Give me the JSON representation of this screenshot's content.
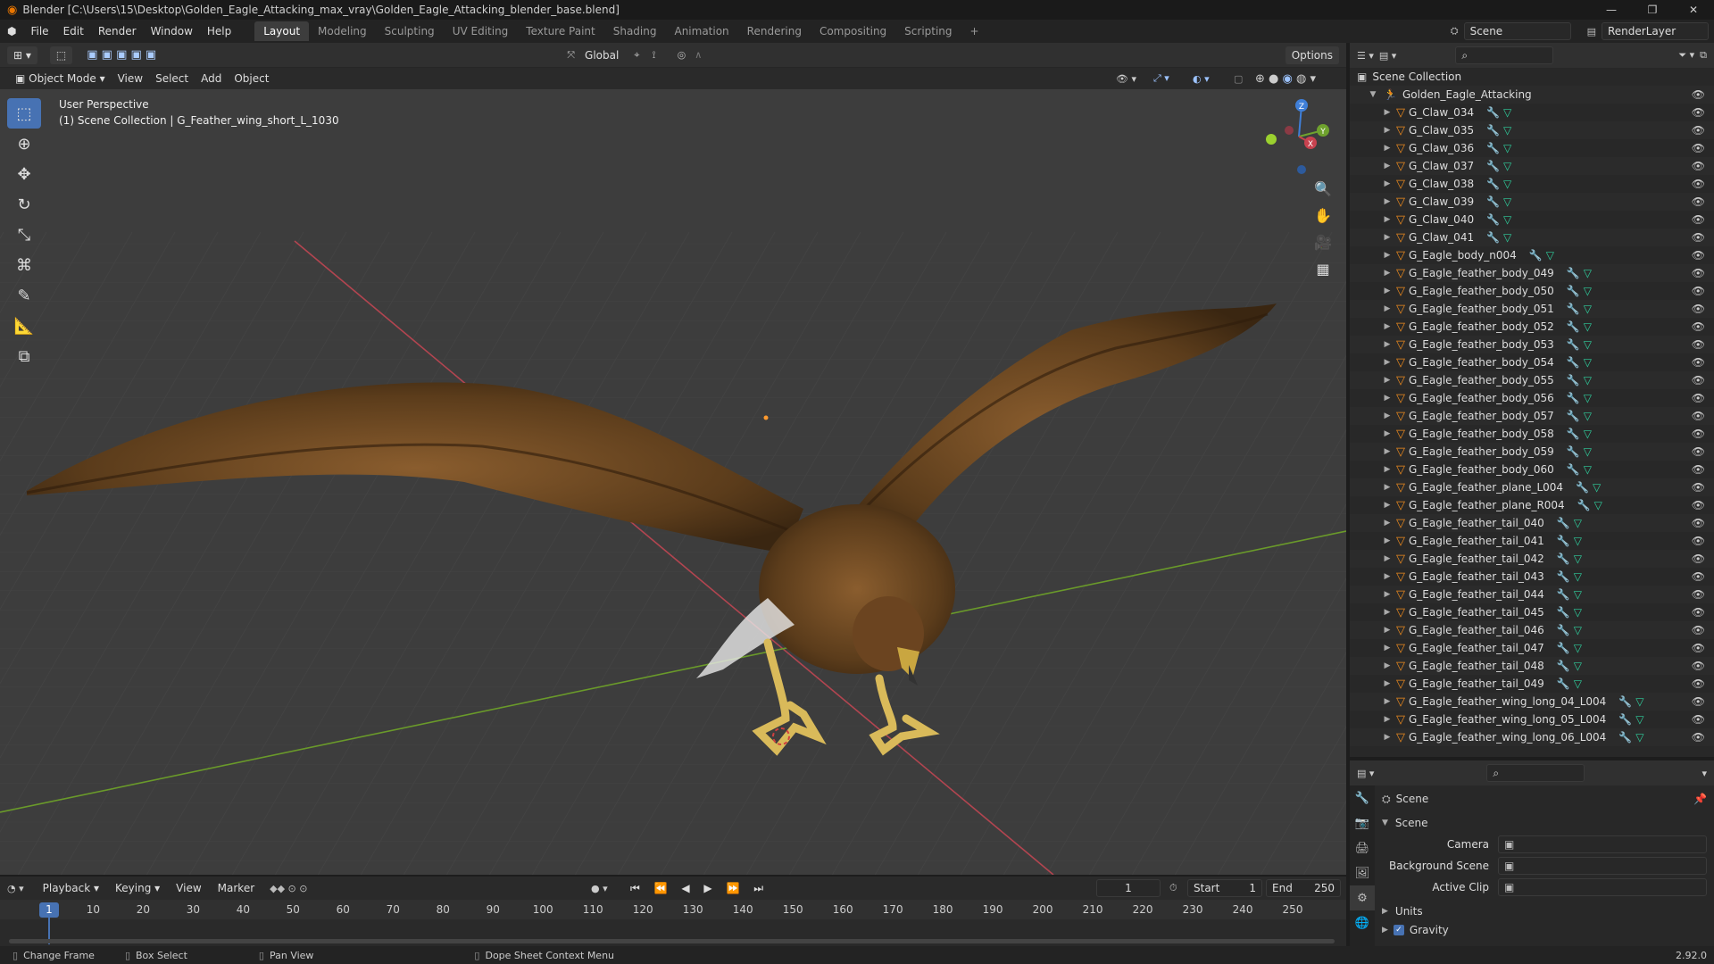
{
  "window": {
    "title": "Blender [C:\\Users\\15\\Desktop\\Golden_Eagle_Attacking_max_vray\\Golden_Eagle_Attacking_blender_base.blend]",
    "controls": [
      "—",
      "❐",
      "✕"
    ]
  },
  "menu": {
    "items": [
      "File",
      "Edit",
      "Render",
      "Window",
      "Help"
    ],
    "workspaces": [
      "Layout",
      "Modeling",
      "Sculpting",
      "UV Editing",
      "Texture Paint",
      "Shading",
      "Animation",
      "Rendering",
      "Compositing",
      "Scripting"
    ],
    "add_tab": "+",
    "scene": "Scene",
    "view_layer": "RenderLayer"
  },
  "tool_header": {
    "orientation": "Global",
    "options": "Options"
  },
  "viewport_header": {
    "mode": "Object Mode",
    "menus": [
      "View",
      "Select",
      "Add",
      "Object"
    ]
  },
  "viewport": {
    "perspective": "User Perspective",
    "collection_info": "(1) Scene Collection | G_Feather_wing_short_L_1030",
    "axis_labels": {
      "x": "X",
      "y": "Y",
      "z": "Z"
    }
  },
  "outliner": {
    "root": "Scene Collection",
    "collection": "Golden_Eagle_Attacking",
    "objects": [
      "G_Claw_034",
      "G_Claw_035",
      "G_Claw_036",
      "G_Claw_037",
      "G_Claw_038",
      "G_Claw_039",
      "G_Claw_040",
      "G_Claw_041",
      "G_Eagle_body_n004",
      "G_Eagle_feather_body_049",
      "G_Eagle_feather_body_050",
      "G_Eagle_feather_body_051",
      "G_Eagle_feather_body_052",
      "G_Eagle_feather_body_053",
      "G_Eagle_feather_body_054",
      "G_Eagle_feather_body_055",
      "G_Eagle_feather_body_056",
      "G_Eagle_feather_body_057",
      "G_Eagle_feather_body_058",
      "G_Eagle_feather_body_059",
      "G_Eagle_feather_body_060",
      "G_Eagle_feather_plane_L004",
      "G_Eagle_feather_plane_R004",
      "G_Eagle_feather_tail_040",
      "G_Eagle_feather_tail_041",
      "G_Eagle_feather_tail_042",
      "G_Eagle_feather_tail_043",
      "G_Eagle_feather_tail_044",
      "G_Eagle_feather_tail_045",
      "G_Eagle_feather_tail_046",
      "G_Eagle_feather_tail_047",
      "G_Eagle_feather_tail_048",
      "G_Eagle_feather_tail_049",
      "G_Eagle_feather_wing_long_04_L004",
      "G_Eagle_feather_wing_long_05_L004",
      "G_Eagle_feather_wing_long_06_L004"
    ]
  },
  "properties": {
    "context": "Scene",
    "panel": "Scene",
    "fields": [
      {
        "label": "Camera",
        "value": ""
      },
      {
        "label": "Background Scene",
        "value": ""
      },
      {
        "label": "Active Clip",
        "value": ""
      }
    ],
    "collapsed_panels": [
      "Units",
      "Gravity"
    ]
  },
  "timeline": {
    "menus": [
      "Playback",
      "Keying",
      "View",
      "Marker"
    ],
    "current_frame": "1",
    "start_label": "Start",
    "start": "1",
    "end_label": "End",
    "end": "250",
    "ruler": [
      "1",
      "10",
      "20",
      "30",
      "40",
      "50",
      "60",
      "70",
      "80",
      "90",
      "100",
      "110",
      "120",
      "130",
      "140",
      "150",
      "160",
      "170",
      "180",
      "190",
      "200",
      "210",
      "220",
      "230",
      "240",
      "250"
    ]
  },
  "statusbar": {
    "items": [
      "Change Frame",
      "Box Select",
      "Pan View",
      "Dope Sheet Context Menu"
    ],
    "version": "2.92.0"
  },
  "colors": {
    "accent": "#4772b3",
    "object_icon": "#f08c1e",
    "mesh_icon": "#2fcf9d",
    "x_axis": "#c8424f",
    "y_axis": "#6fa22e",
    "z_axis": "#3f7fd8"
  }
}
